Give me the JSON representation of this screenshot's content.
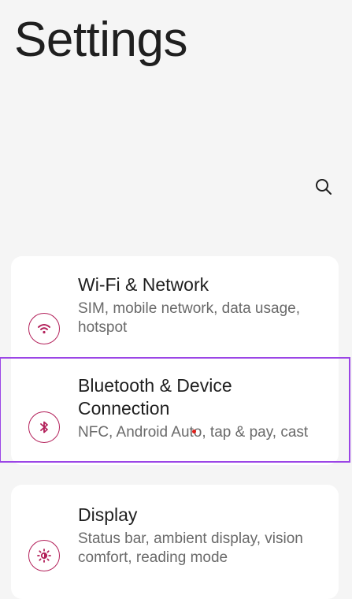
{
  "header": {
    "title": "Settings"
  },
  "search": {
    "icon": "search-icon"
  },
  "settings_items": [
    {
      "title": "Wi-Fi & Network",
      "subtitle": "SIM, mobile network, data usage, hotspot",
      "icon": "wifi-icon"
    },
    {
      "title": "Bluetooth & Device Connection",
      "subtitle": "NFC, Android Auto, tap & pay, cast",
      "icon": "bluetooth-icon"
    },
    {
      "title": "Display",
      "subtitle": "Status bar, ambient display, vision comfort, reading mode",
      "icon": "brightness-icon"
    }
  ],
  "colors": {
    "accent": "#b3205a",
    "highlight": "#9b45e6",
    "background": "#f5f5f5",
    "card": "#ffffff"
  }
}
